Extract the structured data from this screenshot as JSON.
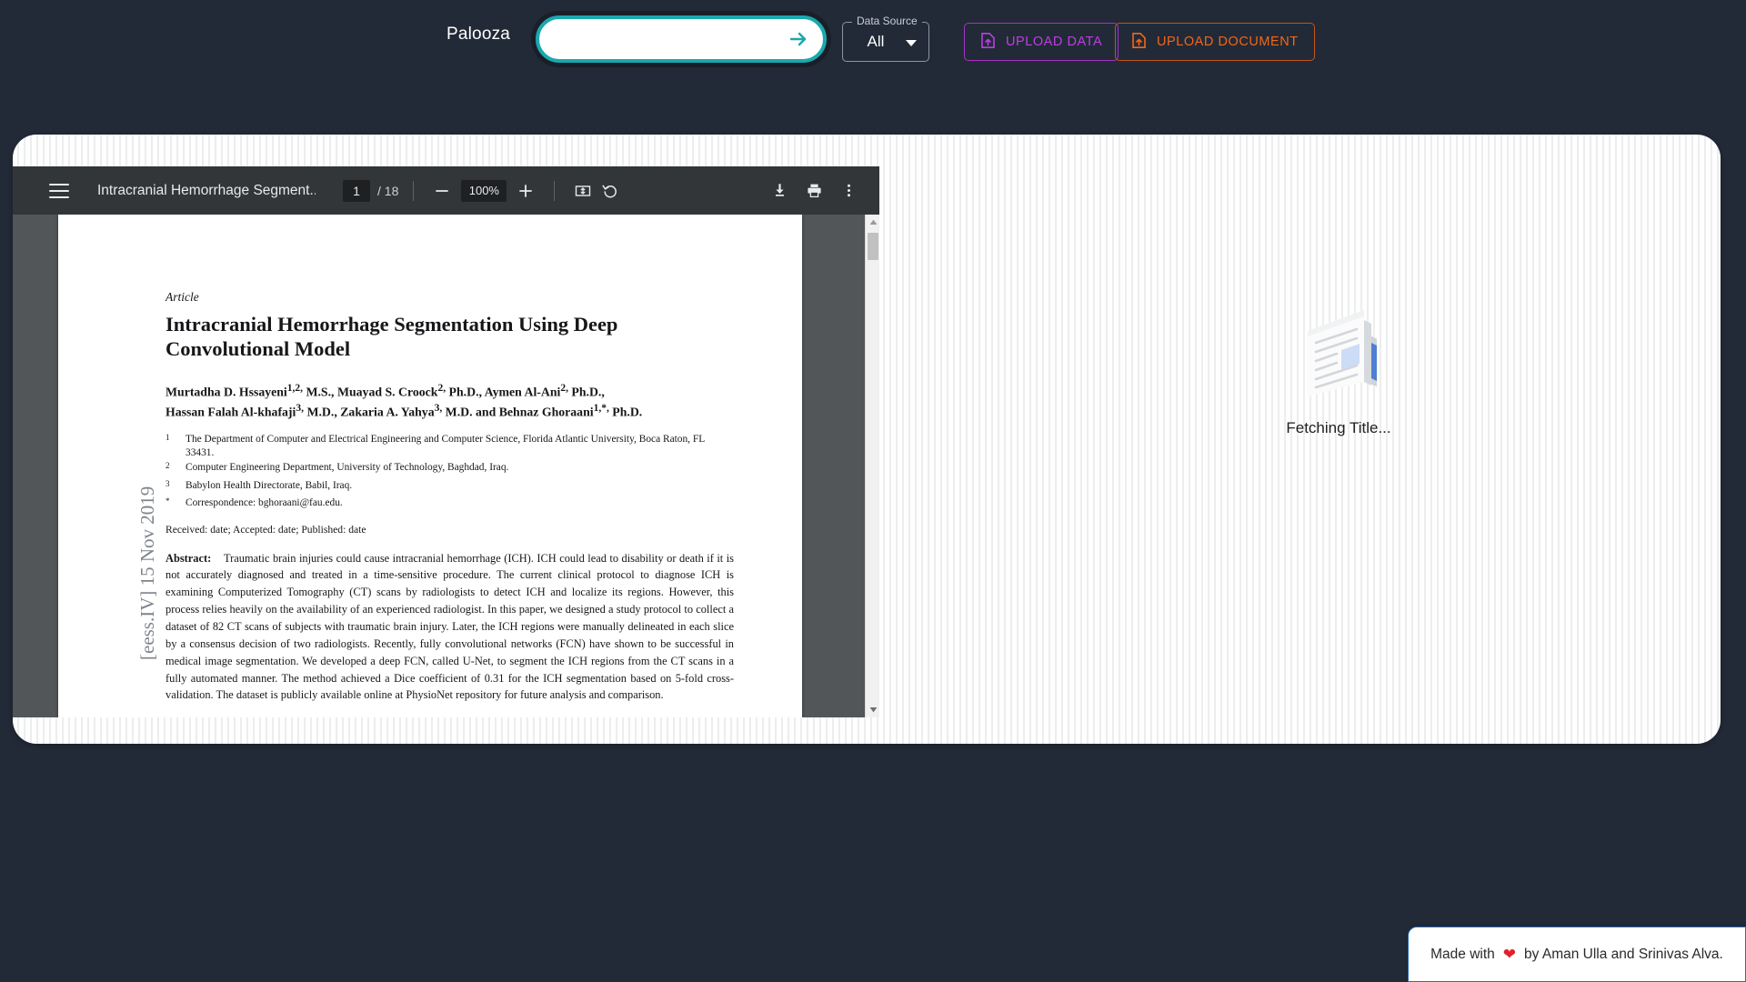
{
  "app": {
    "brand": "Palooza",
    "background_color": "#222a37",
    "accent_color": "#1aa8ad"
  },
  "search": {
    "value": "",
    "placeholder": "",
    "submit_icon": "arrow-right-icon"
  },
  "data_source": {
    "legend": "Data Source",
    "selected": "All",
    "options": [
      "All"
    ]
  },
  "toolbar_buttons": [
    {
      "label": "UPLOAD DATA",
      "icon": "file-upload-icon",
      "color": "#bc3fe0"
    },
    {
      "label": "UPLOAD DOCUMENT",
      "icon": "file-upload-icon",
      "color": "#f4661a"
    }
  ],
  "pdf_viewer": {
    "menu_icon": "hamburger-menu-icon",
    "title": "Intracranial Hemorrhage Segment...",
    "page_current": "1",
    "page_separator": "/ 18",
    "zoom_out_icon": "minus-icon",
    "zoom_level": "100%",
    "zoom_in_icon": "plus-icon",
    "fit_icon": "fit-page-icon",
    "rotate_icon": "rotate-counterclockwise-icon",
    "download_icon": "download-icon",
    "print_icon": "print-icon",
    "more_icon": "more-vertical-icon",
    "scrollbar_up_icon": "scroll-up-arrow-icon",
    "scrollbar_down_icon": "scroll-down-arrow-icon"
  },
  "document": {
    "arxiv_stamp": "[eess.IV]  15 Nov 2019",
    "kind": "Article",
    "title": "Intracranial Hemorrhage Segmentation Using Deep Convolutional Model",
    "authors_line_1": "Murtadha D. Hssayeni1,2, M.S., Muayad S. Croock2, Ph.D., Aymen Al-Ani2, Ph.D.,",
    "authors_line_2": "Hassan Falah Al-khafaji3, M.D., Zakaria A. Yahya3, M.D. and Behnaz Ghoraani1,*, Ph.D.",
    "affiliations": [
      {
        "marker": "1",
        "text": "The Department of Computer and Electrical Engineering and Computer Science, Florida Atlantic University, Boca Raton, FL 33431."
      },
      {
        "marker": "2",
        "text": "Computer Engineering Department, University of Technology, Baghdad, Iraq."
      },
      {
        "marker": "3",
        "text": "Babylon Health Directorate, Babil, Iraq."
      },
      {
        "marker": "*",
        "text": "Correspondence: bghoraani@fau.edu."
      }
    ],
    "dates": "Received: date; Accepted: date; Published: date",
    "abstract_label": "Abstract:",
    "abstract_text": "Traumatic brain injuries could cause intracranial hemorrhage (ICH). ICH could lead to disability or death if it is not accurately diagnosed and treated in a time-sensitive procedure. The current clinical protocol to diagnose ICH is examining Computerized Tomography (CT) scans by radiologists to detect ICH and localize its regions. However, this process relies heavily on the availability of an experienced radiologist. In this paper, we designed a study protocol to collect a dataset of 82 CT scans of subjects with traumatic brain injury. Later, the ICH regions were manually delineated in each slice by a consensus decision of two radiologists. Recently, fully convolutional networks (FCN) have shown to be successful in medical image segmentation. We developed a deep FCN, called U-Net, to segment the ICH regions from the CT scans in a fully automated manner. The method achieved a Dice coefficient of 0.31 for the ICH segmentation based on 5-fold cross-validation. The dataset is publicly available online at PhysioNet repository for future analysis and comparison."
  },
  "fetching": {
    "icon": "document-placeholder-icon",
    "label": "Fetching Title..."
  },
  "footer": {
    "prefix": "Made with",
    "heart_icon": "heart-icon",
    "suffix": "by Aman Ulla and Srinivas Alva."
  }
}
